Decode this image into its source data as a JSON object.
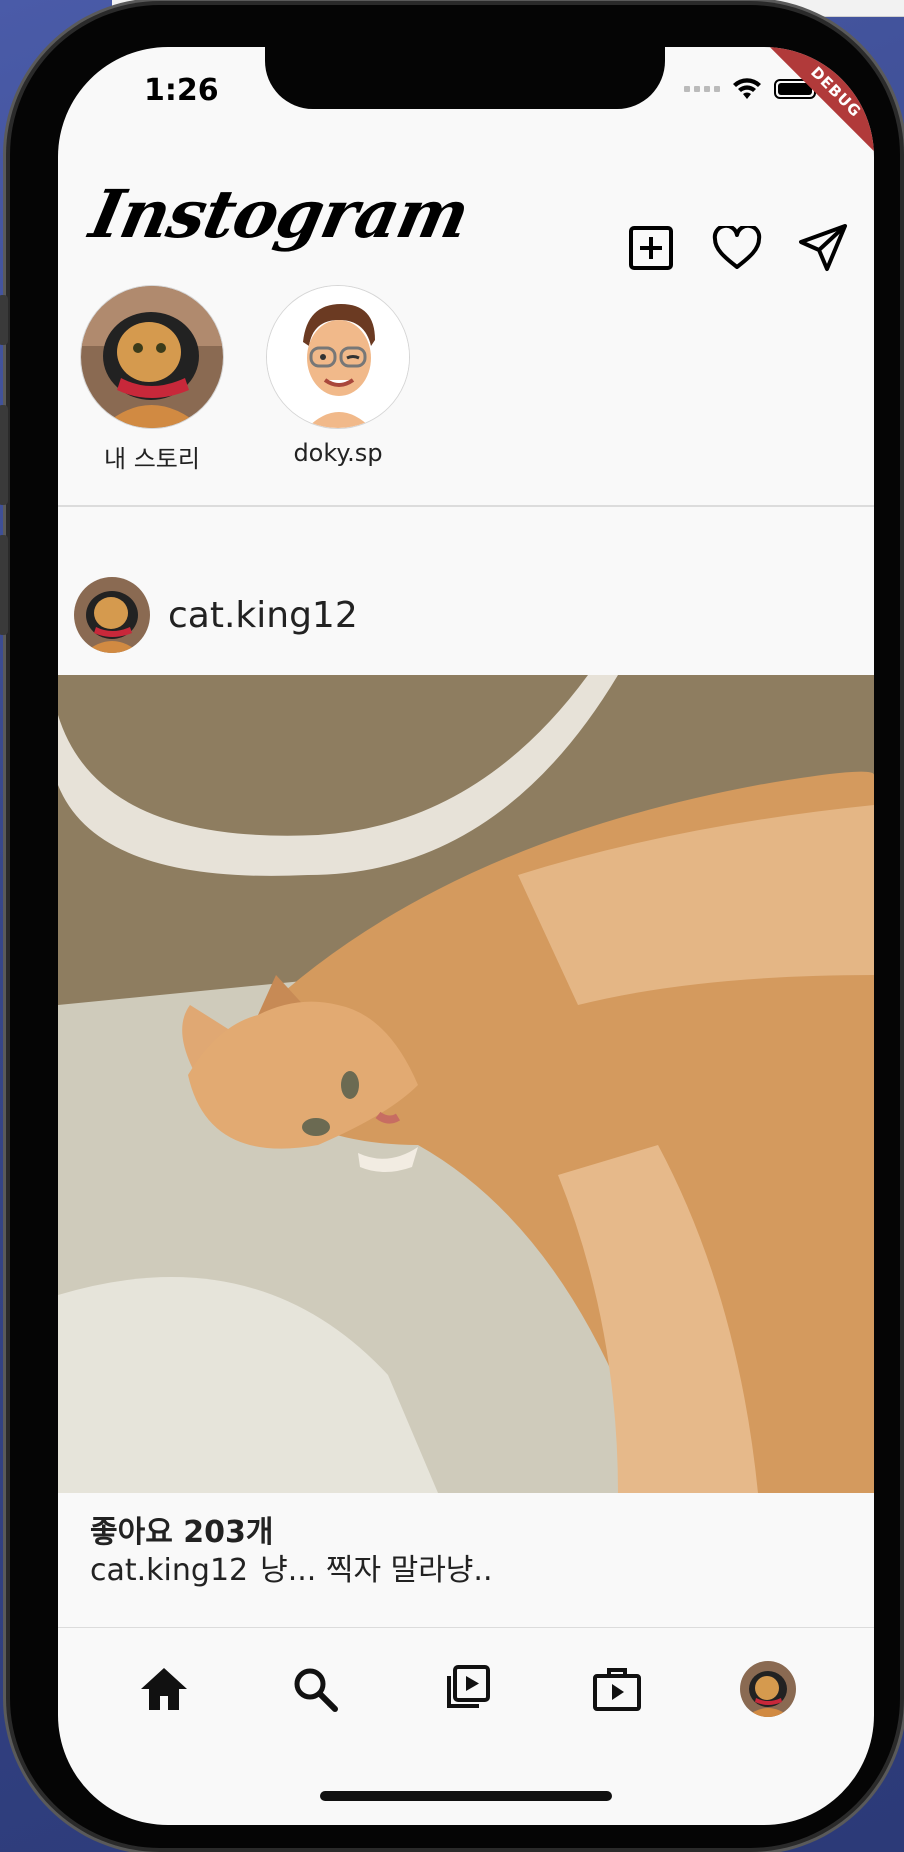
{
  "status_bar": {
    "time": "1:26"
  },
  "debug_banner": "DEBUG",
  "app": {
    "logo": "Instogram"
  },
  "header_actions": [
    {
      "name": "add-post-button",
      "icon": "plus-square-icon"
    },
    {
      "name": "activity-button",
      "icon": "heart-icon"
    },
    {
      "name": "direct-message-button",
      "icon": "send-icon"
    }
  ],
  "stories": [
    {
      "label": "내 스토리",
      "avatar": "cat-avatar"
    },
    {
      "label": "doky.sp",
      "avatar": "memoji-avatar"
    }
  ],
  "post": {
    "username": "cat.king12",
    "image": "orange-tabby-cat-lying-on-floor",
    "likes": "좋아요 203개",
    "caption_user": "cat.king12",
    "caption_text": "냥... 찍자 말라냥.."
  },
  "bottom_nav": [
    {
      "name": "nav-home",
      "icon": "home-icon"
    },
    {
      "name": "nav-search",
      "icon": "search-icon"
    },
    {
      "name": "nav-reels",
      "icon": "reels-icon"
    },
    {
      "name": "nav-shop",
      "icon": "shop-icon"
    },
    {
      "name": "nav-profile",
      "icon": "profile-avatar"
    }
  ]
}
